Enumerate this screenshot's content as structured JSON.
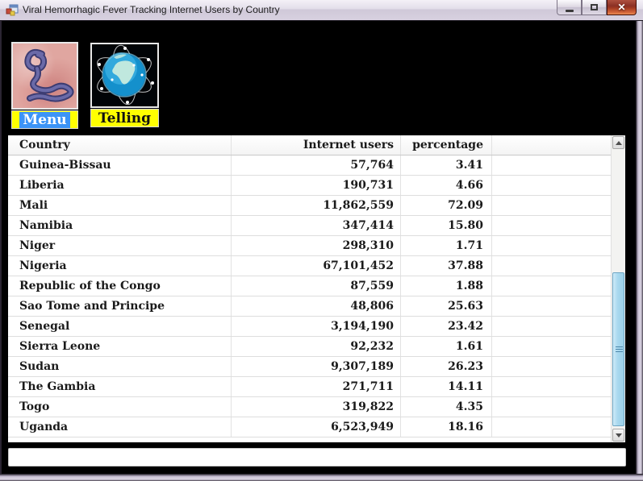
{
  "window": {
    "title": "Viral Hemorrhagic Fever Tracking Internet Users by Country"
  },
  "toolbar": {
    "menu_button": {
      "label": "Menu",
      "image": "ebola-virus-micrograph"
    },
    "telling_button": {
      "label": "Telling",
      "image": "network-globe"
    }
  },
  "grid": {
    "columns": [
      "Country",
      "Internet users",
      "percentage"
    ],
    "rows": [
      {
        "country": "Guinea-Bissau",
        "users": "57,764",
        "pct": "3.41"
      },
      {
        "country": "Liberia",
        "users": "190,731",
        "pct": "4.66"
      },
      {
        "country": "Mali",
        "users": "11,862,559",
        "pct": "72.09"
      },
      {
        "country": "Namibia",
        "users": "347,414",
        "pct": "15.80"
      },
      {
        "country": "Niger",
        "users": "298,310",
        "pct": "1.71"
      },
      {
        "country": "Nigeria",
        "users": "67,101,452",
        "pct": "37.88"
      },
      {
        "country": "Republic of the Congo",
        "users": "87,559",
        "pct": "1.88"
      },
      {
        "country": "Sao Tome and Principe",
        "users": "48,806",
        "pct": "25.63"
      },
      {
        "country": "Senegal",
        "users": "3,194,190",
        "pct": "23.42"
      },
      {
        "country": "Sierra Leone",
        "users": "92,232",
        "pct": "1.61"
      },
      {
        "country": "Sudan",
        "users": "9,307,189",
        "pct": "26.23"
      },
      {
        "country": "The Gambia",
        "users": "271,711",
        "pct": "14.11"
      },
      {
        "country": "Togo",
        "users": "319,822",
        "pct": "4.35"
      },
      {
        "country": "Uganda",
        "users": "6,523,949",
        "pct": "18.16"
      }
    ]
  },
  "bottom_box": {
    "value": "",
    "placeholder": ""
  },
  "colors": {
    "client_background": "#000000",
    "label_yellow": "#ffff00",
    "menu_selection_blue": "#3d94f6",
    "close_button_red": "#a03a22",
    "scroll_thumb_blue": "#a8d8ee",
    "virus_image_pink": "#e0a6a0",
    "globe_teal": "#1ba0d8",
    "titlebar_lavender": "#d8d1e0"
  }
}
